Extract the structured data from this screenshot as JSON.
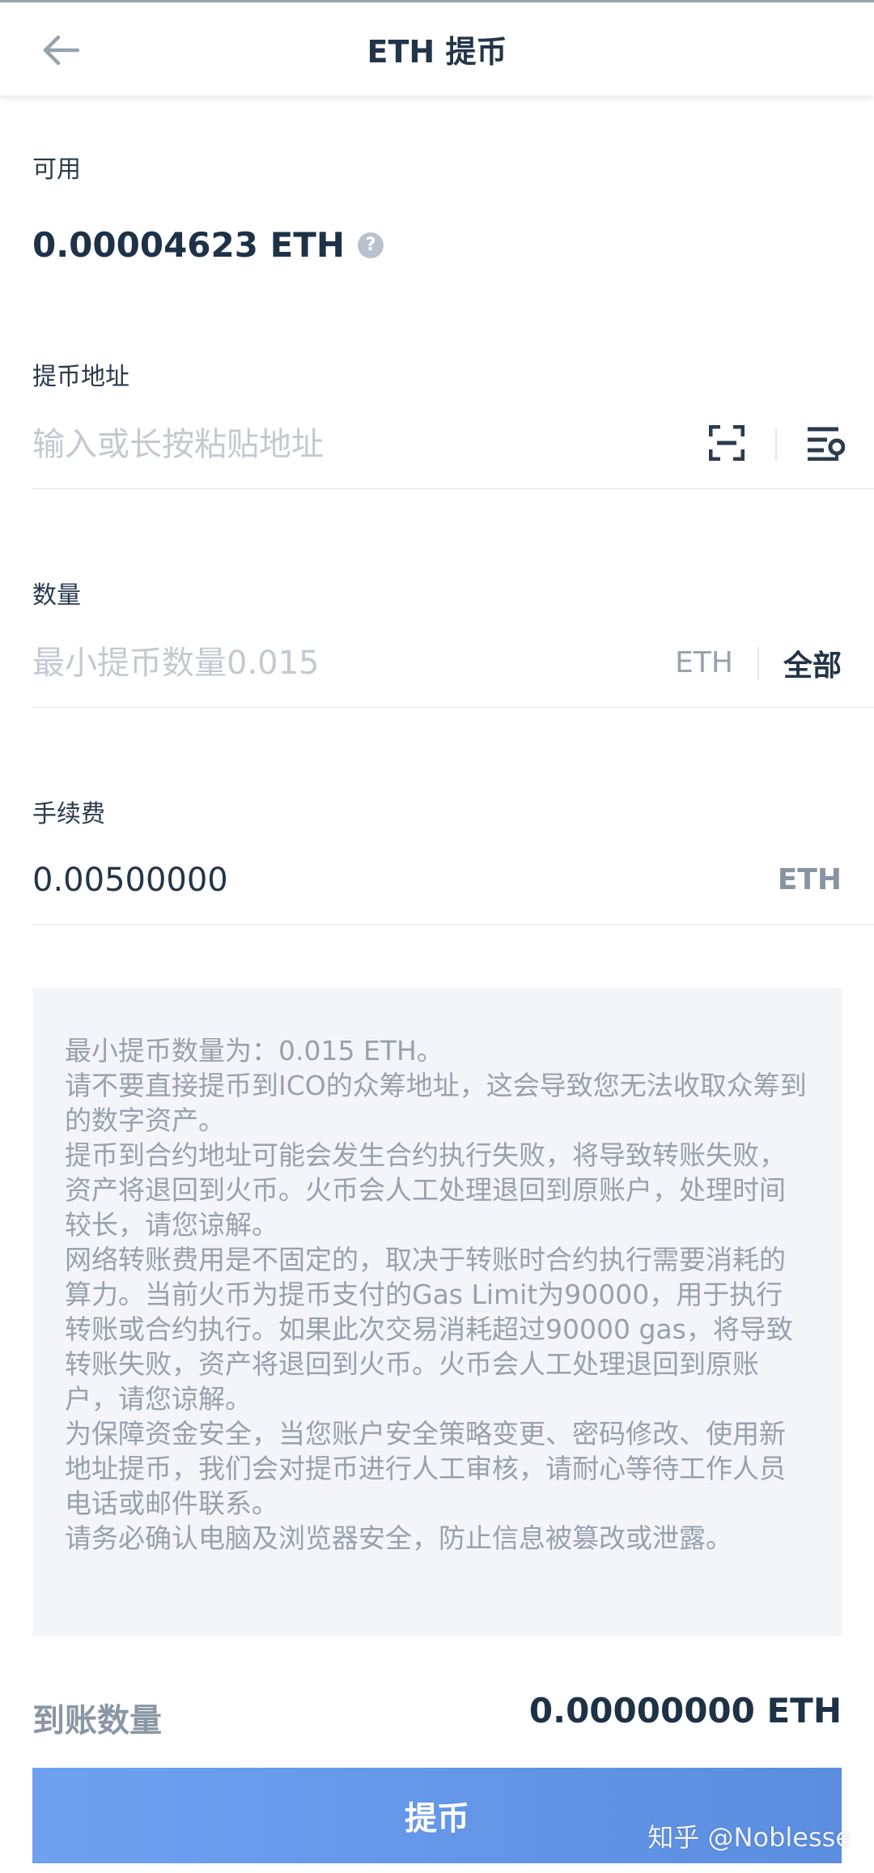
{
  "header": {
    "title": "ETH 提币"
  },
  "available": {
    "label": "可用",
    "value": "0.00004623 ETH",
    "help_symbol": "?"
  },
  "address": {
    "label": "提币地址",
    "placeholder": "输入或长按粘贴地址"
  },
  "amount": {
    "label": "数量",
    "placeholder": "最小提币数量0.015",
    "unit": "ETH",
    "all_label": "全部"
  },
  "fee": {
    "label": "手续费",
    "value": "0.00500000",
    "unit": "ETH"
  },
  "notice": {
    "lines": [
      "最小提币数量为：0.015 ETH。",
      "请不要直接提币到ICO的众筹地址，这会导致您无法收取众筹到的数字资产。",
      "提币到合约地址可能会发生合约执行失败，将导致转账失败，资产将退回到火币。火币会人工处理退回到原账户，处理时间较长，请您谅解。",
      "网络转账费用是不固定的，取决于转账时合约执行需要消耗的算力。当前火币为提币支付的Gas Limit为90000，用于执行转账或合约执行。如果此次交易消耗超过90000 gas，将导致转账失败，资产将退回到火币。火币会人工处理退回到原账户，请您谅解。",
      "为保障资金安全，当您账户安全策略变更、密码修改、使用新地址提币，我们会对提币进行人工审核，请耐心等待工作人员电话或邮件联系。",
      "请务必确认电脑及浏览器安全，防止信息被篡改或泄露。"
    ]
  },
  "arrival": {
    "label": "到账数量",
    "value": "0.00000000 ETH"
  },
  "submit": {
    "label": "提币"
  },
  "watermark": "知乎 @Noblesse",
  "colors": {
    "primary_button": "#6ea1f0",
    "text_dark": "#1e3247",
    "notice_bg": "#f3f5f9"
  },
  "icons": {
    "back": "arrow-left-icon",
    "help": "question-circle-icon",
    "scan": "scan-qr-icon",
    "address_book": "address-book-icon"
  }
}
